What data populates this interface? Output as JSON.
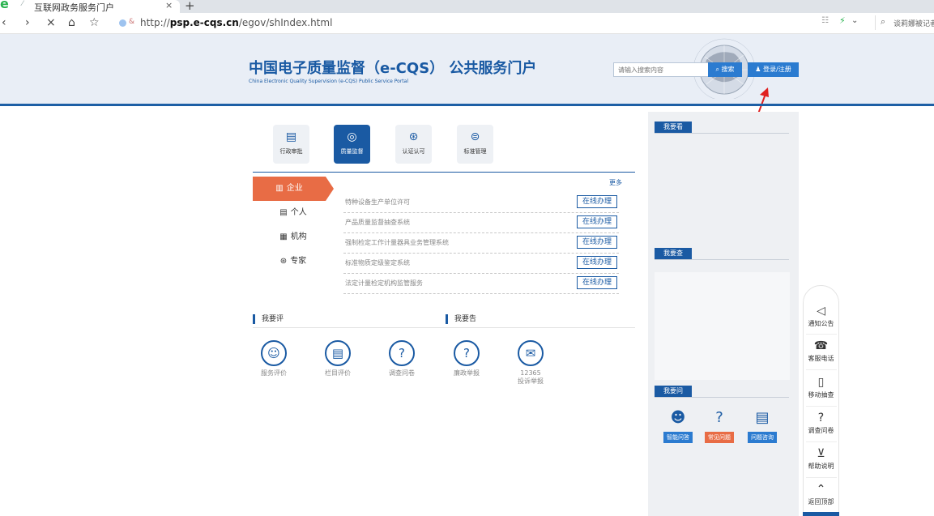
{
  "browser": {
    "logo": "e",
    "tab_title": "互联网政务服务门户",
    "tab_close": "×",
    "tab_new": "+",
    "nav": {
      "back": "‹",
      "forward": "›",
      "stop": "×",
      "home": "⌂",
      "star": "☆"
    },
    "url_prefix": "http://",
    "url_host": "psp.e-cqs.cn",
    "url_path": "/egov/shIndex.html",
    "tools": "☷",
    "search_text": "谈莉娜被记者"
  },
  "header": {
    "title": "中国电子质量监督（e-CQS） 公共服务门户",
    "subtitle": "China Electronic Quality Supervision (e-CQS) Public Service Portal",
    "search_placeholder": "请输入搜索内容",
    "search_button": "搜索",
    "login_button": "登录/注册"
  },
  "service_tabs": [
    {
      "icon": "▤",
      "label": "行政审批",
      "active": false
    },
    {
      "icon": "◎",
      "label": "质量监督",
      "active": true
    },
    {
      "icon": "⊛",
      "label": "认证认可",
      "active": false
    },
    {
      "icon": "⊜",
      "label": "标准管理",
      "active": false
    }
  ],
  "side_menu": [
    {
      "icon": "▥",
      "label": "企业",
      "active": true
    },
    {
      "icon": "▤",
      "label": "个人",
      "active": false
    },
    {
      "icon": "▦",
      "label": "机构",
      "active": false
    },
    {
      "icon": "⊛",
      "label": "专家",
      "active": false
    }
  ],
  "more_label": "更多",
  "services": [
    {
      "name": "特种设备生产单位许可",
      "action": "在线办理"
    },
    {
      "name": "产品质量监督抽查系统",
      "action": "在线办理"
    },
    {
      "name": "强制检定工作计量器具业务管理系统",
      "action": "在线办理"
    },
    {
      "name": "标准物质定级鉴定系统",
      "action": "在线办理"
    },
    {
      "name": "法定计量检定机构监管服务",
      "action": "在线办理"
    }
  ],
  "section_evaluate": "我要评",
  "section_report": "我要告",
  "feedback_items": [
    {
      "icon": "☺",
      "label": "服务评价",
      "label2": ""
    },
    {
      "icon": "▤",
      "label": "栏目评价",
      "label2": ""
    },
    {
      "icon": "?",
      "label": "调查问卷",
      "label2": ""
    },
    {
      "icon": "?",
      "label": "廉政举报",
      "label2": ""
    },
    {
      "icon": "✉",
      "label": "12365",
      "label2": "投诉举报"
    }
  ],
  "right_panel": {
    "see": "我要看",
    "check": "我要查",
    "ask": "我要问",
    "ask_items": [
      {
        "icon": "☻",
        "label": "智能问答",
        "style": "blue"
      },
      {
        "icon": "?",
        "label": "常见问题",
        "style": "orange"
      },
      {
        "icon": "▤",
        "label": "问题咨询",
        "style": "blue"
      }
    ]
  },
  "float_bar": [
    {
      "icon": "◁",
      "label": "通知公告"
    },
    {
      "icon": "☎",
      "label": "客服电话"
    },
    {
      "icon": "▯",
      "label": "移动抽查"
    },
    {
      "icon": "?",
      "label": "调查问卷"
    },
    {
      "icon": "⊻",
      "label": "帮助说明"
    },
    {
      "icon": "⌃",
      "label": "返回顶部"
    }
  ],
  "colors": {
    "brand_blue": "#1a5aa3",
    "button_blue": "#2b7bd0",
    "accent_orange": "#e86c45"
  }
}
